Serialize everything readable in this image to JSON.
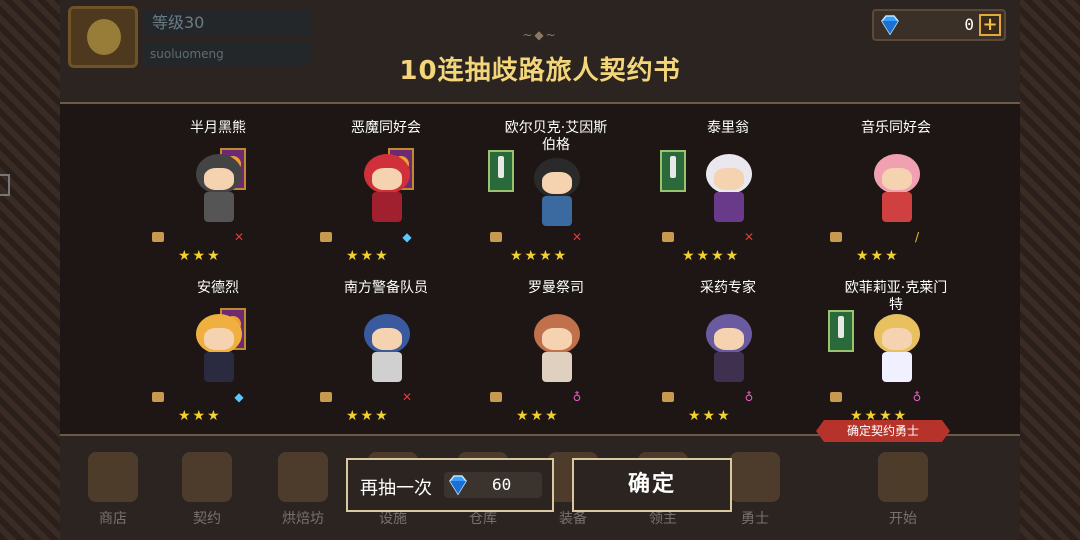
{
  "player": {
    "level": "等级30",
    "name": "suoluomeng"
  },
  "currency": {
    "gems": "0",
    "plus": "+"
  },
  "title": "10连抽歧路旅人契约书",
  "header_deco": "~◆~",
  "characters": [
    {
      "name": "半月黑熊",
      "stars": "★★★",
      "banner": "purple",
      "weapon_icon": "sword-icon"
    },
    {
      "name": "恶魔同好会",
      "stars": "★★★",
      "banner": "purple",
      "weapon_icon": "gem-icon"
    },
    {
      "name": "欧尔贝克·艾因斯伯格",
      "stars": "★★★★",
      "banner": "green",
      "weapon_icon": "sword-icon"
    },
    {
      "name": "泰里翁",
      "stars": "★★★★",
      "banner": "green",
      "weapon_icon": "sword-icon"
    },
    {
      "name": "音乐同好会",
      "stars": "★★★",
      "banner": "none",
      "weapon_icon": "staff-icon"
    },
    {
      "name": "安德烈",
      "stars": "★★★",
      "banner": "purple",
      "weapon_icon": "gem-icon"
    },
    {
      "name": "南方警备队员",
      "stars": "★★★",
      "banner": "none",
      "weapon_icon": "sword-icon"
    },
    {
      "name": "罗曼祭司",
      "stars": "★★★",
      "banner": "none",
      "weapon_icon": "potion-icon"
    },
    {
      "name": "采药专家",
      "stars": "★★★",
      "banner": "none",
      "weapon_icon": "potion-icon"
    },
    {
      "name": "欧菲莉亚·克莱门特",
      "stars": "★★★★",
      "banner": "green",
      "weapon_icon": "potion-icon"
    }
  ],
  "confirm_tag": "确定契约勇士",
  "buttons": {
    "again_label": "再抽一次",
    "again_cost": "60",
    "ok_label": "确定"
  },
  "bottom_nav": [
    "商店",
    "契约",
    "烘焙坊",
    "设施",
    "仓库",
    "装备",
    "领主",
    "勇士",
    "开始"
  ],
  "colors": {
    "title": "#f3d67a",
    "star": "#f2d132",
    "tag": "#b5332a",
    "border": "#d9c8a0"
  }
}
